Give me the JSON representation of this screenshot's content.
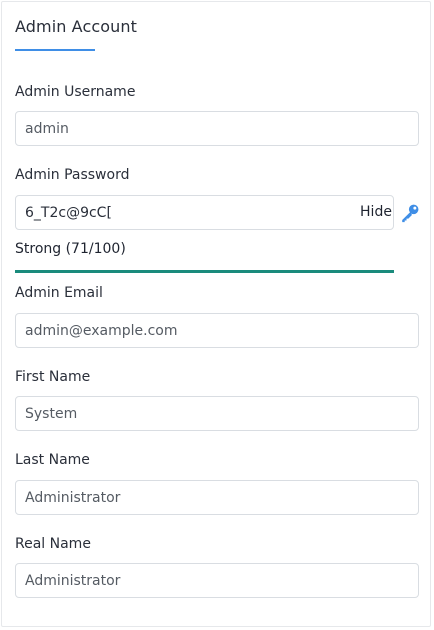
{
  "section": {
    "title": "Admin Account"
  },
  "fields": {
    "username": {
      "label": "Admin Username",
      "value": "admin"
    },
    "password": {
      "label": "Admin Password",
      "value": "6_T2c@9cC[",
      "toggle_label": "Hide"
    },
    "strength": {
      "text": "Strong (71/100)",
      "level": 1.0,
      "color": "#1a8b7c"
    },
    "email": {
      "label": "Admin Email",
      "value": "admin@example.com"
    },
    "first_name": {
      "label": "First Name",
      "value": "System"
    },
    "last_name": {
      "label": "Last Name",
      "value": "Administrator"
    },
    "real_name": {
      "label": "Real Name",
      "value": "Administrator"
    }
  },
  "icons": {
    "generate_password": "key-icon"
  },
  "colors": {
    "accent": "#3f8ee6",
    "strength_bar": "#1a8b7c"
  }
}
